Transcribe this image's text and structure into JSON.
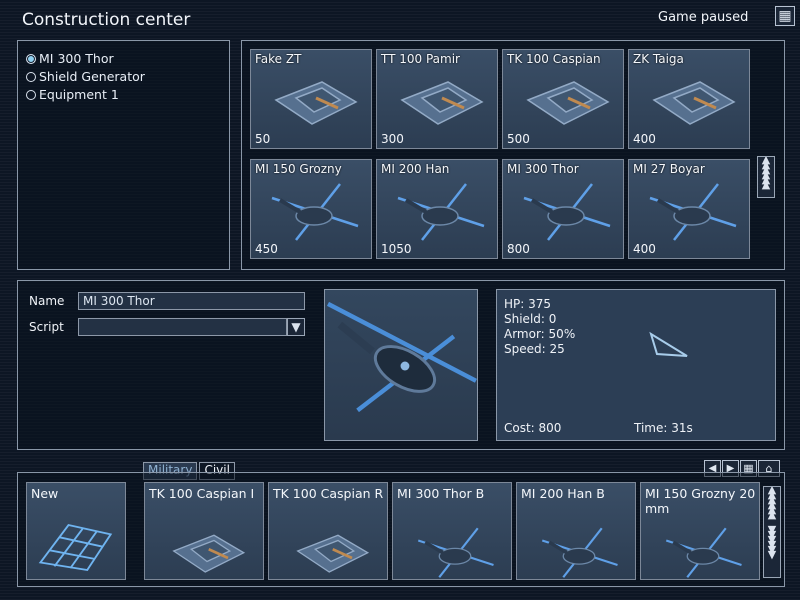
{
  "window": {
    "title": "Construction center",
    "status": "Game paused",
    "close_icon": "close-grid-icon"
  },
  "selector": {
    "items": [
      {
        "label": "MI 300 Thor",
        "selected": true
      },
      {
        "label": "Shield Generator",
        "selected": false
      },
      {
        "label": "Equipment 1",
        "selected": false
      }
    ]
  },
  "catalog": {
    "units": [
      {
        "name": "Fake ZT",
        "cost": "50",
        "kind": "tank"
      },
      {
        "name": "TT 100 Pamir",
        "cost": "300",
        "kind": "tank"
      },
      {
        "name": "TK 100 Caspian",
        "cost": "500",
        "kind": "tank"
      },
      {
        "name": "ZK Taiga",
        "cost": "400",
        "kind": "tank"
      },
      {
        "name": "MI 150 Grozny",
        "cost": "450",
        "kind": "heli"
      },
      {
        "name": "MI 200 Han",
        "cost": "1050",
        "kind": "heli"
      },
      {
        "name": "MI 300 Thor",
        "cost": "800",
        "kind": "heli"
      },
      {
        "name": "MI 27 Boyar",
        "cost": "400",
        "kind": "heli"
      }
    ]
  },
  "details": {
    "name_label": "Name",
    "name_value": "MI 300 Thor",
    "script_label": "Script",
    "script_value": "",
    "hp": "HP: 375",
    "shield": "Shield: 0",
    "armor": "Armor: 50%",
    "speed": "Speed: 25",
    "cost": "Cost: 800",
    "time": "Time: 31s"
  },
  "templates": {
    "tabs": [
      {
        "label": "Military",
        "active": true
      },
      {
        "label": "Civil",
        "active": false
      }
    ],
    "new_label": "New",
    "items": [
      {
        "name": "TK 100 Caspian I",
        "kind": "tank"
      },
      {
        "name": "TK 100 Caspian R",
        "kind": "tank"
      },
      {
        "name": "MI 300 Thor B",
        "kind": "heli"
      },
      {
        "name": "MI 200 Han B",
        "kind": "heli"
      },
      {
        "name": "MI 150 Grozny 20 mm",
        "kind": "heli"
      }
    ]
  },
  "colors": {
    "background": "#0d1624",
    "panel_border": "#8a97a8",
    "card": "#34485f",
    "accent": "#8fd0f0"
  }
}
